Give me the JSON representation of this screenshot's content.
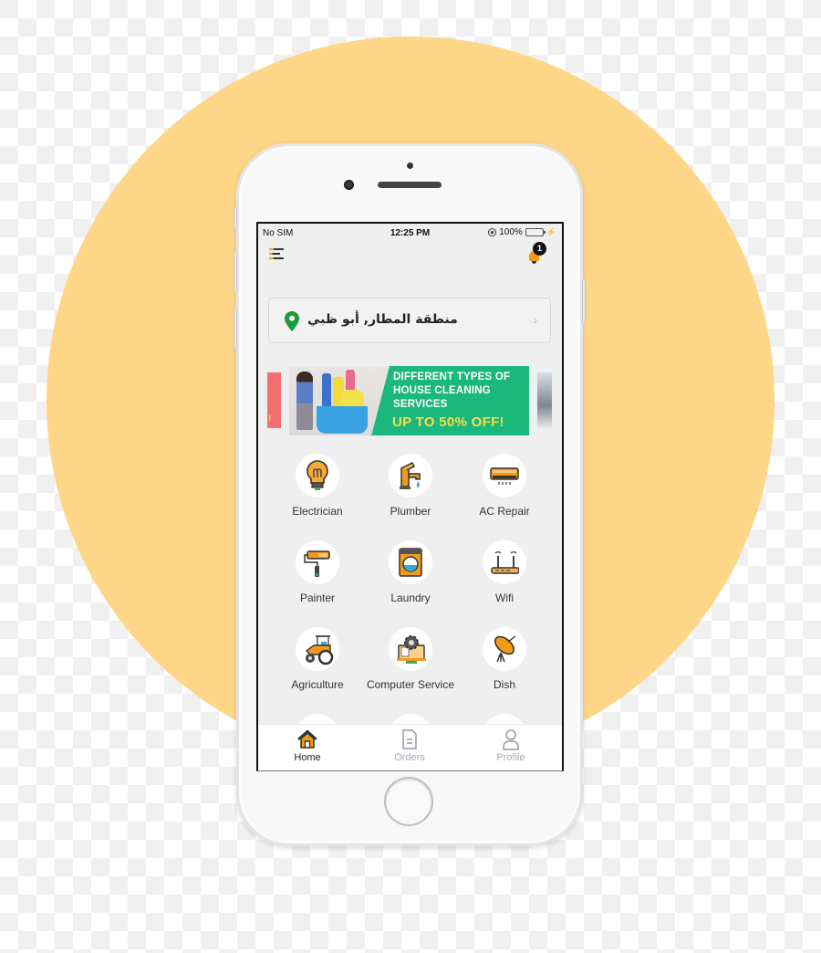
{
  "status_bar": {
    "carrier": "No SIM",
    "time": "12:25 PM",
    "battery": "100%",
    "battery_level": 1.0
  },
  "header": {
    "menu_icon": "hamburger-menu-icon",
    "notification_icon": "bell-icon",
    "notification_count": "1"
  },
  "location": {
    "icon": "map-pin-icon",
    "address": "منطقة المطار, أبو ظبي",
    "chevron": "›"
  },
  "banner": {
    "headline_lines": [
      "DIFFERENT TYPES OF",
      "HOUSE CLEANING",
      "SERVICES"
    ],
    "promo": "UP TO 50% OFF!",
    "left_slide_fragment": "!",
    "colors": {
      "main_bg": "#1ab87c",
      "promo": "#f7dd4a",
      "left_slide": "#f66f6f"
    }
  },
  "services": [
    {
      "label": "Electrician",
      "icon": "lightbulb-icon"
    },
    {
      "label": "Plumber",
      "icon": "faucet-icon"
    },
    {
      "label": "AC Repair",
      "icon": "air-conditioner-icon"
    },
    {
      "label": "Painter",
      "icon": "paint-roller-icon"
    },
    {
      "label": "Laundry",
      "icon": "washing-machine-icon"
    },
    {
      "label": "Wifi",
      "icon": "router-icon"
    },
    {
      "label": "Agriculture",
      "icon": "tractor-icon"
    },
    {
      "label": "Computer Service",
      "icon": "computer-gear-icon"
    },
    {
      "label": "Dish",
      "icon": "satellite-dish-icon"
    }
  ],
  "tabbar": {
    "tabs": [
      {
        "label": "Home",
        "icon": "home-icon",
        "active": true
      },
      {
        "label": "Orders",
        "icon": "document-icon",
        "active": false
      },
      {
        "label": "Profile",
        "icon": "user-icon",
        "active": false
      }
    ]
  },
  "theme": {
    "accent": "#f29a1a",
    "background_circle": "#fdd688",
    "screen_bg": "#efefef",
    "pin_green": "#1a9b3a"
  }
}
